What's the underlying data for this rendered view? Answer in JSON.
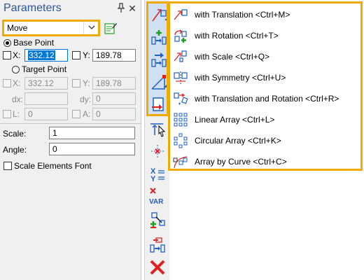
{
  "panel": {
    "title": "Parameters",
    "pin_glyph": "📌",
    "close_glyph": "✕",
    "mode": {
      "value": "Move",
      "chevron": "⌄"
    },
    "base_point": {
      "label": "Base Point",
      "selected": true,
      "x_label": "X:",
      "x_value": "332.12",
      "y_label": "Y:",
      "y_value": "189.78"
    },
    "target_point": {
      "label": "Target Point",
      "selected": false,
      "x_label": "X:",
      "x_value": "332.12",
      "y_label": "Y:",
      "y_value": "189.78",
      "dx_label": "dx:",
      "dx_value": "",
      "dy_label": "dy:",
      "dy_value": "0",
      "l_label": "L:",
      "l_value": "0",
      "a_label": "A:",
      "a_value": "0"
    },
    "scale": {
      "label": "Scale:",
      "value": "1"
    },
    "angle": {
      "label": "Angle:",
      "value": "0"
    },
    "scale_font": {
      "label": "Scale Elements Font",
      "checked": false
    }
  },
  "toolbar": {
    "group_buttons": [
      "move-icon",
      "move-copy-icon",
      "move-forward-icon",
      "move-scale-icon",
      "move-to-icon"
    ],
    "buttons": [
      "align-icon",
      "snap-point-icon",
      "variables-icon",
      "var-delete-icon",
      "transform-icon",
      "move-save-icon",
      "cancel-icon"
    ],
    "var_text": "VAR"
  },
  "menu": {
    "items": [
      {
        "label": "with Translation <Ctrl+M>",
        "icon": "translation-icon"
      },
      {
        "label": "with Rotation <Ctrl+T>",
        "icon": "rotation-icon"
      },
      {
        "label": "with Scale <Ctrl+Q>",
        "icon": "scale-icon"
      },
      {
        "label": "with Symmetry <Ctrl+U>",
        "icon": "symmetry-icon"
      },
      {
        "label": "with Translation and Rotation <Ctrl+R>",
        "icon": "translation-rotation-icon"
      },
      {
        "label": "Linear Array <Ctrl+L>",
        "icon": "linear-array-icon"
      },
      {
        "label": "Circular Array <Ctrl+K>",
        "icon": "circular-array-icon"
      },
      {
        "label": "Array by Curve <Ctrl+C>",
        "icon": "array-curve-icon"
      }
    ]
  },
  "colors": {
    "highlight": "#f2a900",
    "title": "#2b579a",
    "selection": "#0078d7",
    "icon_blue": "#1f5fbf",
    "icon_red": "#e02020",
    "icon_green": "#1ea01e"
  }
}
